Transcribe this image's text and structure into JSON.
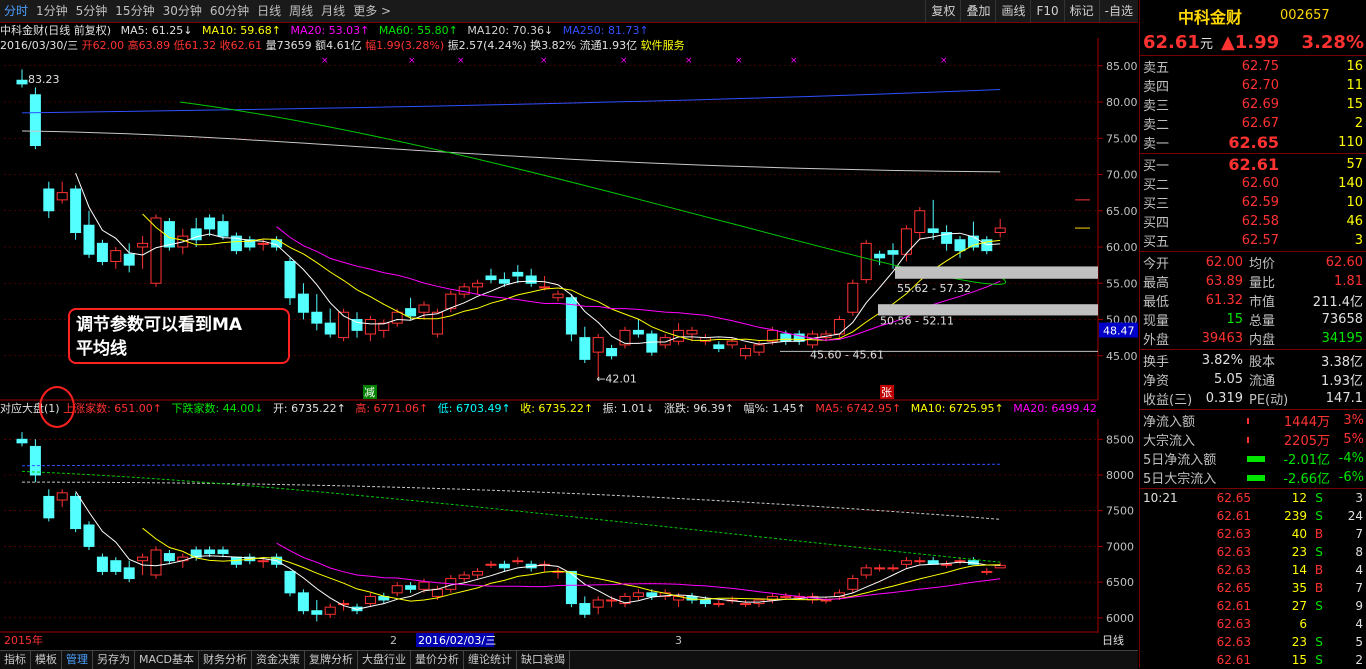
{
  "toolbar": {
    "timeframes": [
      "分时",
      "1分钟",
      "5分钟",
      "15分钟",
      "30分钟",
      "60分钟",
      "日线",
      "周线",
      "月线",
      "更多 >"
    ],
    "buttons": [
      "复权",
      "叠加",
      "画线",
      "F10",
      "标记",
      "-自选"
    ]
  },
  "stock_header": {
    "name_line": "中科金财(日线 前复权)",
    "ma5": "MA5: 61.25↓",
    "ma10": "MA10: 59.68↑",
    "ma20": "MA20: 53.03↑",
    "ma60": "MA60: 55.80↑",
    "ma120": "MA120: 70.36↓",
    "ma250": "MA250: 81.73↑",
    "date": "2016/03/30/三",
    "open": "开62.00",
    "high": "高63.89",
    "low": "低61.32",
    "close": "收62.61",
    "volume": "量73659",
    "amount": "额4.61亿",
    "change": "幅1.99(3.28%)",
    "amplitude": "振2.57(4.24%)",
    "turnover": "换3.82%",
    "float": "流通1.93亿",
    "sector": "软件服务"
  },
  "main_axis": {
    "ticks": [
      "85.00",
      "80.00",
      "75.00",
      "70.00",
      "65.00",
      "60.00",
      "55.00",
      "50.00",
      "45.00"
    ],
    "current_label": "48.47"
  },
  "main_annotations": {
    "high_label": "83.23",
    "low_label": "←42.01",
    "range1": "55.62 - 57.32",
    "range2": "50.56 - 52.11",
    "range3": "45.60 - 45.61",
    "jian": "减",
    "zhang": "张"
  },
  "callout": {
    "line1": "调节参数可以看到MA",
    "line2": "平均线"
  },
  "index_header": {
    "name": "对应大盘(1)",
    "up": "上涨家数: 651.00↑",
    "down": "下跌家数: 44.00↓",
    "open": "开: 6735.22↑",
    "high": "高: 6771.06↑",
    "low": "低: 6703.49↑",
    "close": "收: 6735.22↑",
    "zhen": "振: 1.01↓",
    "zhangdie": "涨跌: 96.39↑",
    "fu": "幅%: 1.45↑",
    "ma5": "MA5: 6742.95↑",
    "ma10": "MA10: 6725.95↑",
    "ma20": "MA20: 6499.42↑",
    "ma_more": "MA"
  },
  "index_axis": {
    "ticks": [
      "8500",
      "8000",
      "7500",
      "7000",
      "6500",
      "6000"
    ]
  },
  "x_axis": {
    "labels": [
      "2015年",
      "2",
      "2016/02/03/三",
      "3"
    ]
  },
  "period_label": "日线",
  "bottom_tabs": [
    "指标",
    "模板",
    "管理",
    "另存为",
    "MACD基本",
    "财务分析",
    "资金决策",
    "复牌分析",
    "大盘行业",
    "量价分析",
    "缠论统计",
    "缺口衰竭"
  ],
  "right_panel": {
    "name": "中科金财",
    "code": "002657",
    "price": "62.61",
    "unit": "元",
    "change": "▲1.99",
    "pct": "3.28%",
    "asks": [
      {
        "label": "卖五",
        "price": "62.75",
        "vol": "16"
      },
      {
        "label": "卖四",
        "price": "62.70",
        "vol": "11"
      },
      {
        "label": "卖三",
        "price": "62.69",
        "vol": "15"
      },
      {
        "label": "卖二",
        "price": "62.67",
        "vol": "2"
      },
      {
        "label": "卖一",
        "price": "62.65",
        "vol": "110"
      }
    ],
    "bids": [
      {
        "label": "买一",
        "price": "62.61",
        "vol": "57"
      },
      {
        "label": "买二",
        "price": "62.60",
        "vol": "140"
      },
      {
        "label": "买三",
        "price": "62.59",
        "vol": "10"
      },
      {
        "label": "买四",
        "price": "62.58",
        "vol": "46"
      },
      {
        "label": "买五",
        "price": "62.57",
        "vol": "3"
      }
    ],
    "stats": [
      {
        "l1": "今开",
        "v1": "62.00",
        "l2": "均价",
        "v2": "62.60"
      },
      {
        "l1": "最高",
        "v1": "63.89",
        "l2": "量比",
        "v2": "1.81"
      },
      {
        "l1": "最低",
        "v1": "61.32",
        "l2": "市值",
        "v2": "211.4亿"
      },
      {
        "l1": "现量",
        "v1": "15",
        "l2": "总量",
        "v2": "73658"
      },
      {
        "l1": "外盘",
        "v1": "39463",
        "l2": "内盘",
        "v2": "34195"
      }
    ],
    "stats2": [
      {
        "l1": "换手",
        "v1": "3.82%",
        "l2": "股本",
        "v2": "3.38亿"
      },
      {
        "l1": "净资",
        "v1": "5.05",
        "l2": "流通",
        "v2": "1.93亿"
      },
      {
        "l1": "收益(三)",
        "v1": "0.319",
        "l2": "PE(动)",
        "v2": "147.1"
      }
    ],
    "flows": [
      {
        "label": "净流入额",
        "val": "1444万",
        "pct": "3%"
      },
      {
        "label": "大宗流入",
        "val": "2205万",
        "pct": "5%"
      },
      {
        "label": "5日净流入额",
        "val": "-2.01亿",
        "pct": "-4%"
      },
      {
        "label": "5日大宗流入",
        "val": "-2.66亿",
        "pct": "-6%"
      }
    ],
    "trades": [
      {
        "time": "10:21",
        "price": "62.65",
        "vol": "12",
        "side": "S",
        "n": "3"
      },
      {
        "time": "",
        "price": "62.61",
        "vol": "239",
        "side": "S",
        "n": "24"
      },
      {
        "time": "",
        "price": "62.63",
        "vol": "40",
        "side": "B",
        "n": "7"
      },
      {
        "time": "",
        "price": "62.63",
        "vol": "23",
        "side": "S",
        "n": "8"
      },
      {
        "time": "",
        "price": "62.63",
        "vol": "14",
        "side": "B",
        "n": "4"
      },
      {
        "time": "",
        "price": "62.65",
        "vol": "35",
        "side": "B",
        "n": "7"
      },
      {
        "time": "",
        "price": "62.61",
        "vol": "27",
        "side": "S",
        "n": "9"
      },
      {
        "time": "",
        "price": "62.63",
        "vol": "6",
        "side": "",
        "n": "4"
      },
      {
        "time": "",
        "price": "62.63",
        "vol": "23",
        "side": "S",
        "n": "5"
      },
      {
        "time": "",
        "price": "62.61",
        "vol": "15",
        "side": "S",
        "n": "2"
      }
    ]
  },
  "chart_data": [
    {
      "type": "candlestick",
      "ylim": [
        40,
        88
      ],
      "ohlc": [
        [
          83.0,
          84.5,
          82.0,
          82.5
        ],
        [
          81.0,
          82.0,
          73.5,
          74.0
        ],
        [
          68.0,
          69.0,
          64.0,
          65.0
        ],
        [
          66.5,
          69.0,
          66.0,
          67.5
        ],
        [
          68.0,
          68.5,
          61.0,
          62.0
        ],
        [
          63.0,
          65.0,
          58.5,
          59.0
        ],
        [
          60.5,
          61.0,
          57.5,
          58.0
        ],
        [
          58.0,
          60.0,
          57.0,
          59.5
        ],
        [
          59.0,
          60.5,
          56.5,
          57.5
        ],
        [
          60.0,
          61.5,
          57.0,
          60.5
        ],
        [
          55.0,
          64.5,
          54.5,
          64.0
        ],
        [
          63.5,
          64.0,
          59.5,
          60.0
        ],
        [
          60.0,
          62.5,
          59.0,
          61.5
        ],
        [
          62.5,
          64.0,
          60.0,
          61.0
        ],
        [
          64.0,
          64.5,
          61.5,
          62.5
        ],
        [
          63.5,
          64.5,
          61.0,
          61.5
        ],
        [
          61.5,
          62.0,
          59.0,
          59.5
        ],
        [
          61.0,
          61.5,
          59.5,
          60.0
        ],
        [
          60.5,
          61.0,
          59.5,
          60.5
        ],
        [
          61.0,
          61.5,
          59.5,
          60.0
        ],
        [
          58.0,
          58.5,
          52.0,
          53.0
        ],
        [
          53.5,
          55.0,
          50.0,
          51.0
        ],
        [
          51.0,
          53.5,
          48.5,
          49.5
        ],
        [
          49.5,
          51.5,
          47.5,
          48.0
        ],
        [
          47.5,
          51.5,
          47.0,
          51.0
        ],
        [
          50.0,
          51.0,
          47.5,
          48.5
        ],
        [
          48.0,
          50.5,
          47.0,
          50.0
        ],
        [
          48.5,
          50.0,
          47.5,
          49.5
        ],
        [
          49.5,
          51.5,
          49.0,
          51.0
        ],
        [
          51.5,
          53.0,
          50.0,
          50.5
        ],
        [
          51.0,
          52.5,
          50.0,
          52.0
        ],
        [
          48.0,
          51.5,
          47.5,
          51.0
        ],
        [
          51.5,
          54.0,
          51.0,
          53.5
        ],
        [
          53.5,
          55.0,
          53.0,
          54.5
        ],
        [
          54.5,
          55.5,
          53.5,
          55.0
        ],
        [
          56.0,
          57.0,
          55.0,
          55.5
        ],
        [
          55.5,
          56.5,
          54.5,
          55.0
        ],
        [
          56.5,
          57.5,
          55.0,
          56.0
        ],
        [
          56.0,
          57.0,
          54.5,
          55.0
        ],
        [
          54.5,
          56.0,
          54.0,
          54.5
        ],
        [
          53.0,
          54.0,
          52.5,
          53.5
        ],
        [
          53.0,
          53.5,
          47.0,
          48.0
        ],
        [
          47.5,
          49.0,
          44.0,
          44.5
        ],
        [
          45.5,
          48.0,
          42.0,
          47.5
        ],
        [
          46.0,
          46.5,
          44.5,
          45.0
        ],
        [
          46.5,
          49.0,
          46.0,
          48.5
        ],
        [
          48.5,
          50.0,
          47.5,
          48.0
        ],
        [
          48.0,
          48.5,
          45.0,
          45.5
        ],
        [
          46.5,
          48.0,
          46.0,
          47.5
        ],
        [
          47.0,
          49.5,
          46.5,
          48.5
        ],
        [
          48.0,
          49.0,
          47.0,
          48.5
        ],
        [
          47.0,
          48.0,
          46.5,
          47.5
        ],
        [
          46.5,
          47.0,
          45.5,
          46.0
        ],
        [
          46.5,
          47.5,
          46.0,
          47.0
        ],
        [
          45.0,
          46.5,
          44.5,
          46.0
        ],
        [
          45.5,
          47.0,
          45.0,
          46.5
        ],
        [
          47.0,
          49.0,
          46.5,
          48.5
        ],
        [
          48.0,
          48.5,
          46.5,
          47.0
        ],
        [
          48.0,
          48.5,
          46.5,
          47.0
        ],
        [
          46.5,
          48.5,
          46.0,
          48.0
        ],
        [
          47.5,
          48.5,
          47.0,
          48.0
        ],
        [
          48.0,
          50.5,
          47.5,
          50.0
        ],
        [
          51.0,
          55.5,
          50.5,
          55.0
        ],
        [
          55.5,
          61.0,
          55.0,
          60.5
        ],
        [
          59.0,
          59.5,
          57.5,
          58.5
        ],
        [
          59.5,
          60.5,
          57.0,
          59.0
        ],
        [
          59.0,
          63.0,
          58.0,
          62.5
        ],
        [
          62.0,
          65.5,
          61.0,
          65.0
        ],
        [
          62.5,
          66.5,
          61.0,
          62.0
        ],
        [
          62.0,
          63.0,
          59.5,
          60.5
        ],
        [
          61.0,
          61.5,
          58.5,
          59.5
        ],
        [
          61.5,
          63.5,
          59.5,
          60.0
        ],
        [
          61.0,
          61.5,
          59.0,
          59.5
        ],
        [
          62.0,
          63.89,
          61.32,
          62.61
        ]
      ],
      "ma5_last": 61.25,
      "ma10_last": 59.68,
      "ma20_last": 53.03,
      "ma60_last": 55.8,
      "ma120_last": 70.36,
      "ma250_last": 81.73
    },
    {
      "type": "candlestick",
      "ylim": [
        5900,
        8700
      ],
      "ohlc": [
        [
          8500,
          8600,
          8400,
          8450
        ],
        [
          8400,
          8500,
          7900,
          8000
        ],
        [
          7700,
          7800,
          7350,
          7400
        ],
        [
          7650,
          7800,
          7550,
          7750
        ],
        [
          7700,
          7750,
          7200,
          7250
        ],
        [
          7300,
          7350,
          6950,
          7000
        ],
        [
          6850,
          6900,
          6600,
          6650
        ],
        [
          6800,
          6850,
          6600,
          6650
        ],
        [
          6700,
          6800,
          6500,
          6550
        ],
        [
          6800,
          6900,
          6600,
          6850
        ],
        [
          6600,
          7000,
          6550,
          6950
        ],
        [
          6900,
          6950,
          6750,
          6800
        ],
        [
          6800,
          6900,
          6700,
          6850
        ],
        [
          6950,
          7000,
          6800,
          6850
        ],
        [
          6950,
          7000,
          6850,
          6900
        ],
        [
          6950,
          7000,
          6850,
          6900
        ],
        [
          6850,
          6850,
          6700,
          6750
        ],
        [
          6850,
          6900,
          6750,
          6800
        ],
        [
          6800,
          6850,
          6700,
          6800
        ],
        [
          6850,
          6900,
          6700,
          6750
        ],
        [
          6650,
          6650,
          6300,
          6350
        ],
        [
          6350,
          6400,
          6050,
          6100
        ],
        [
          6100,
          6250,
          5950,
          6050
        ],
        [
          6050,
          6200,
          6000,
          6150
        ],
        [
          6200,
          6250,
          6100,
          6200
        ],
        [
          6150,
          6200,
          6050,
          6100
        ],
        [
          6200,
          6350,
          6150,
          6300
        ],
        [
          6300,
          6350,
          6200,
          6250
        ],
        [
          6350,
          6500,
          6300,
          6450
        ],
        [
          6450,
          6500,
          6350,
          6400
        ],
        [
          6400,
          6550,
          6350,
          6500
        ],
        [
          6300,
          6450,
          6250,
          6400
        ],
        [
          6400,
          6600,
          6350,
          6550
        ],
        [
          6550,
          6650,
          6500,
          6600
        ],
        [
          6600,
          6700,
          6550,
          6650
        ],
        [
          6750,
          6800,
          6700,
          6750
        ],
        [
          6750,
          6800,
          6650,
          6700
        ],
        [
          6800,
          6850,
          6750,
          6800
        ],
        [
          6750,
          6800,
          6650,
          6700
        ],
        [
          6750,
          6800,
          6650,
          6750
        ],
        [
          6650,
          6700,
          6550,
          6650
        ],
        [
          6650,
          6650,
          6150,
          6200
        ],
        [
          6200,
          6300,
          6000,
          6050
        ],
        [
          6150,
          6300,
          6050,
          6250
        ],
        [
          6250,
          6300,
          6150,
          6250
        ],
        [
          6200,
          6350,
          6150,
          6300
        ],
        [
          6300,
          6400,
          6250,
          6350
        ],
        [
          6350,
          6400,
          6250,
          6300
        ],
        [
          6300,
          6400,
          6250,
          6350
        ],
        [
          6250,
          6350,
          6150,
          6300
        ],
        [
          6300,
          6350,
          6200,
          6250
        ],
        [
          6250,
          6300,
          6150,
          6200
        ],
        [
          6200,
          6250,
          6150,
          6200
        ],
        [
          6250,
          6300,
          6200,
          6250
        ],
        [
          6200,
          6250,
          6150,
          6200
        ],
        [
          6200,
          6250,
          6150,
          6250
        ],
        [
          6250,
          6350,
          6200,
          6300
        ],
        [
          6300,
          6350,
          6250,
          6300
        ],
        [
          6300,
          6350,
          6250,
          6300
        ],
        [
          6250,
          6350,
          6200,
          6300
        ],
        [
          6250,
          6300,
          6200,
          6250
        ],
        [
          6300,
          6400,
          6250,
          6350
        ],
        [
          6400,
          6600,
          6350,
          6550
        ],
        [
          6600,
          6750,
          6550,
          6700
        ],
        [
          6700,
          6750,
          6650,
          6700
        ],
        [
          6700,
          6750,
          6650,
          6700
        ],
        [
          6750,
          6850,
          6700,
          6800
        ],
        [
          6800,
          6850,
          6750,
          6800
        ],
        [
          6800,
          6850,
          6750,
          6750
        ],
        [
          6750,
          6800,
          6700,
          6750
        ],
        [
          6800,
          6850,
          6750,
          6800
        ],
        [
          6800,
          6850,
          6750,
          6750
        ],
        [
          6650,
          6700,
          6600,
          6650
        ],
        [
          6700,
          6771,
          6703,
          6735
        ]
      ],
      "ma5_last": 6742.95,
      "ma10_last": 6725.95,
      "ma20_last": 6499.42
    }
  ]
}
